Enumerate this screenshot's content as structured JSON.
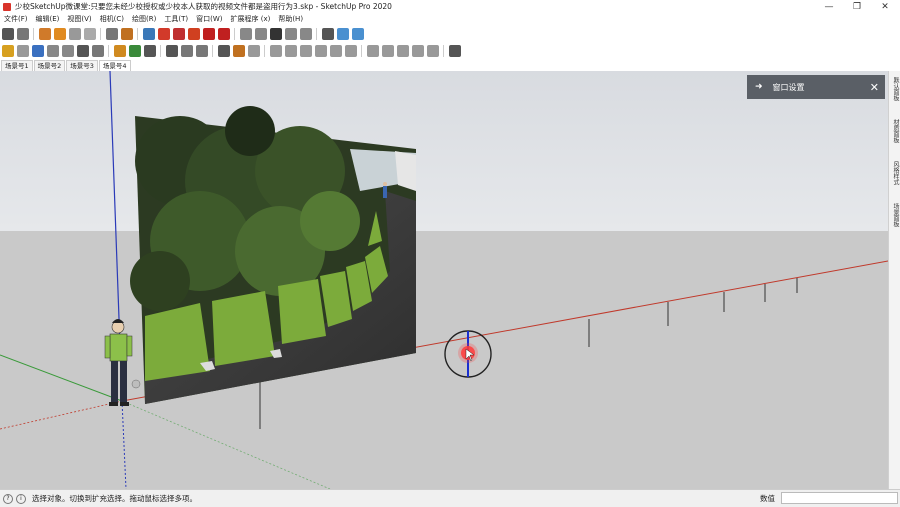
{
  "window": {
    "title": "少校SketchUp微课堂:只要您未经少校授权或少校本人获取的视频文件都是盗用行为3.skp - SketchUp Pro 2020",
    "min": "—",
    "max": "❐",
    "close": "✕"
  },
  "menu": [
    "文件(F)",
    "编辑(E)",
    "视图(V)",
    "相机(C)",
    "绘图(R)",
    "工具(T)",
    "窗口(W)",
    "扩展程序 (x)",
    "帮助(H)"
  ],
  "toolbar1": [
    {
      "icon": "select-icon",
      "color": "#555555"
    },
    {
      "icon": "paint-icon",
      "color": "#777777"
    },
    {
      "icon": "orbit-icon",
      "color": "#d07a2a"
    },
    {
      "icon": "play-icon",
      "color": "#e08a20"
    },
    {
      "icon": "stop-icon",
      "color": "#999999"
    },
    {
      "icon": "prev-icon",
      "color": "#aaaaaa"
    },
    {
      "icon": "walk-icon",
      "color": "#777777"
    },
    {
      "icon": "position-camera-icon",
      "color": "#c07020"
    },
    {
      "icon": "print-icon",
      "color": "#3a78b8"
    },
    {
      "icon": "settings-red-icon",
      "color": "#d23a2a"
    },
    {
      "icon": "layout-icon",
      "color": "#c03030"
    },
    {
      "icon": "sun-icon",
      "color": "#d04020"
    },
    {
      "icon": "gear-red-icon",
      "color": "#c02020"
    },
    {
      "icon": "photo-icon",
      "color": "#c02020"
    },
    {
      "icon": "new-file-icon",
      "color": "#888888"
    },
    {
      "icon": "open-folder-icon",
      "color": "#888888"
    },
    {
      "icon": "save-icon",
      "color": "#333333"
    },
    {
      "icon": "cut-icon",
      "color": "#888888"
    },
    {
      "icon": "copy-icon",
      "color": "#888888"
    },
    {
      "icon": "xray-icon",
      "color": "#555555"
    },
    {
      "icon": "style-icon",
      "color": "#4a90d0"
    },
    {
      "icon": "hidden-icon",
      "color": "#4a90d0"
    }
  ],
  "toolbar2": [
    {
      "icon": "component-icon",
      "color": "#d7a020"
    },
    {
      "icon": "rotate-icon",
      "color": "#999999"
    },
    {
      "icon": "paint-bucket-icon",
      "color": "#3a70c0"
    },
    {
      "icon": "eraser-icon",
      "color": "#888888"
    },
    {
      "icon": "material-icon",
      "color": "#888888"
    },
    {
      "icon": "tape-icon",
      "color": "#555555"
    },
    {
      "icon": "protractor-icon",
      "color": "#777777"
    },
    {
      "icon": "shield-icon",
      "color": "#d08a20"
    },
    {
      "icon": "tree-icon",
      "color": "#3a8a3a"
    },
    {
      "icon": "camera-icon",
      "color": "#555555"
    },
    {
      "icon": "speaker-icon",
      "color": "#555555"
    },
    {
      "icon": "dimension-icon",
      "color": "#777777"
    },
    {
      "icon": "text-icon",
      "color": "#777777"
    },
    {
      "icon": "section-icon",
      "color": "#555555"
    },
    {
      "icon": "axes-icon",
      "color": "#c07020"
    },
    {
      "icon": "sandbox-icon",
      "color": "#999999"
    },
    {
      "icon": "view-iso-icon",
      "color": "#999999"
    },
    {
      "icon": "view-top-icon",
      "color": "#999999"
    },
    {
      "icon": "view-front-icon",
      "color": "#999999"
    },
    {
      "icon": "view-right-icon",
      "color": "#999999"
    },
    {
      "icon": "view-back-icon",
      "color": "#999999"
    },
    {
      "icon": "view-left-icon",
      "color": "#999999"
    },
    {
      "icon": "solid-icon",
      "color": "#999999"
    },
    {
      "icon": "wire-icon",
      "color": "#999999"
    },
    {
      "icon": "shaded-icon",
      "color": "#999999"
    },
    {
      "icon": "texture-icon",
      "color": "#999999"
    },
    {
      "icon": "mono-icon",
      "color": "#999999"
    },
    {
      "icon": "globe-icon",
      "color": "#555555"
    }
  ],
  "scenes": [
    {
      "label": "场景号1",
      "active": false
    },
    {
      "label": "场景号2",
      "active": false
    },
    {
      "label": "场景号3",
      "active": false
    },
    {
      "label": "场景号4",
      "active": true
    }
  ],
  "tray_panel": {
    "arrow": "➜",
    "title": "窗口设置",
    "close": "✕"
  },
  "right_tray_tabs": [
    "默认面板",
    "材质面板",
    "风格样式",
    "场景面板"
  ],
  "status": {
    "help": "?",
    "info": "i",
    "text": "选择对象。切换到扩充选择。拖动鼠标选择多项。",
    "vcb_label": "数值"
  },
  "colors": {
    "sky": "#dcdfe3",
    "ground": "#c9c9c9",
    "red_axis": "#c0392b",
    "green_axis": "#3a9a3a",
    "blue_axis": "#2a3ab8",
    "foliage_dark": "#2a3a22",
    "foliage_mid": "#4a6a2a",
    "bench_green": "#7aa83a",
    "path_gray": "#3e3e3e",
    "panel_gray": "#5a5f66",
    "cursor_red": "#ff3030"
  }
}
